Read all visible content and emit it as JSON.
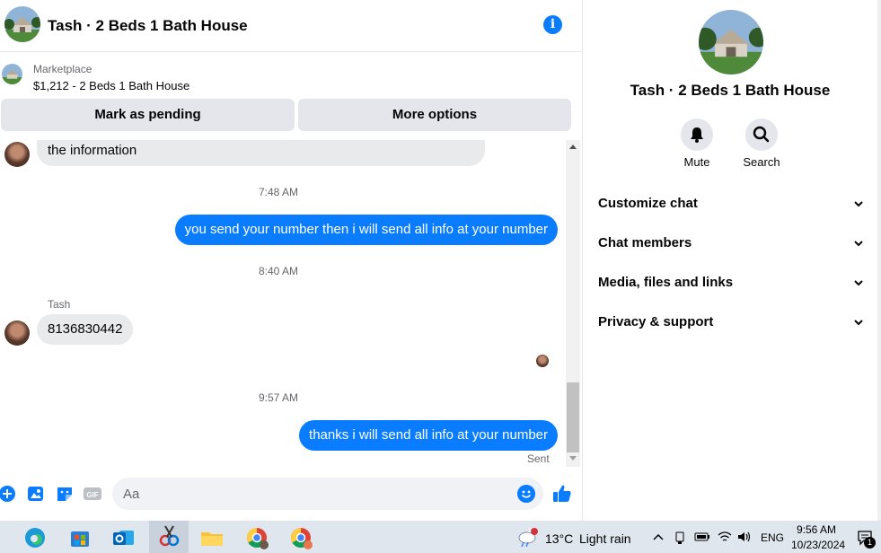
{
  "header": {
    "title": "Tash · 2 Beds 1 Bath House",
    "info_icon_glyph": "i"
  },
  "marketplace": {
    "label": "Marketplace",
    "listing": "$1,212 - 2 Beds 1 Bath House"
  },
  "actions": {
    "mark_pending": "Mark as pending",
    "more_options": "More options"
  },
  "messages": {
    "m1_text": "the information",
    "t1": "7:48 AM",
    "m2_text": "you send your number then i will send all info at your number",
    "t2": "8:40 AM",
    "sender_name": "Tash",
    "m3_text": "8136830442",
    "t3": "9:57 AM",
    "m4_text": "thanks i will send all info at your number",
    "status": "Sent"
  },
  "composer": {
    "placeholder": "Aa",
    "gif_label": "GIF"
  },
  "info_panel": {
    "name": "Tash · 2 Beds 1 Bath House",
    "mute_label": "Mute",
    "search_label": "Search",
    "sections": [
      "Customize chat",
      "Chat members",
      "Media, files and links",
      "Privacy & support"
    ]
  },
  "taskbar": {
    "weather_temp": "13°C",
    "weather_desc": "Light rain",
    "language": "ENG",
    "time": "9:56 AM",
    "date": "10/23/2024",
    "notification_count": "1",
    "weather_badge": "1"
  },
  "colors": {
    "accent": "#0a7cff",
    "bubble_in": "#e9eaec",
    "button_bg": "#e4e6eb",
    "secondary_text": "#65676b"
  }
}
